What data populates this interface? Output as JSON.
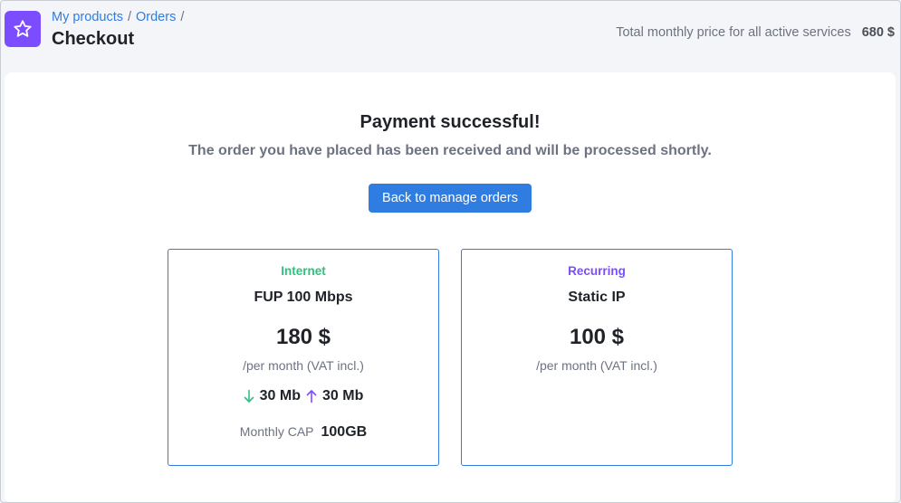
{
  "header": {
    "breadcrumb": [
      {
        "label": "My products"
      },
      {
        "label": "Orders"
      }
    ],
    "breadcrumb_separator": "/",
    "title": "Checkout",
    "total_label": "Total monthly price for all active services",
    "total_value": "680 $"
  },
  "main": {
    "success_title": "Payment successful!",
    "success_message": "The order you have placed has been received and will be processed shortly.",
    "back_button": "Back to manage orders"
  },
  "cards": [
    {
      "tag": "Internet",
      "tag_color": "#2ec27e",
      "name": "FUP 100 Mbps",
      "price": "180 $",
      "period": "/per month (VAT incl.)",
      "download": "30 Mb",
      "upload": "30 Mb",
      "cap_label": "Monthly CAP",
      "cap_value": "100GB"
    },
    {
      "tag": "Recurring",
      "tag_color": "#7c4dff",
      "name": "Static IP",
      "price": "100 $",
      "period": "/per month (VAT incl.)"
    }
  ],
  "colors": {
    "accent": "#2f7de1",
    "brand": "#7c4dff",
    "download_arrow": "#2ec27e",
    "upload_arrow": "#7c4dff"
  },
  "icons": {
    "logo": "star-icon",
    "download": "arrow-down-icon",
    "upload": "arrow-up-icon"
  }
}
